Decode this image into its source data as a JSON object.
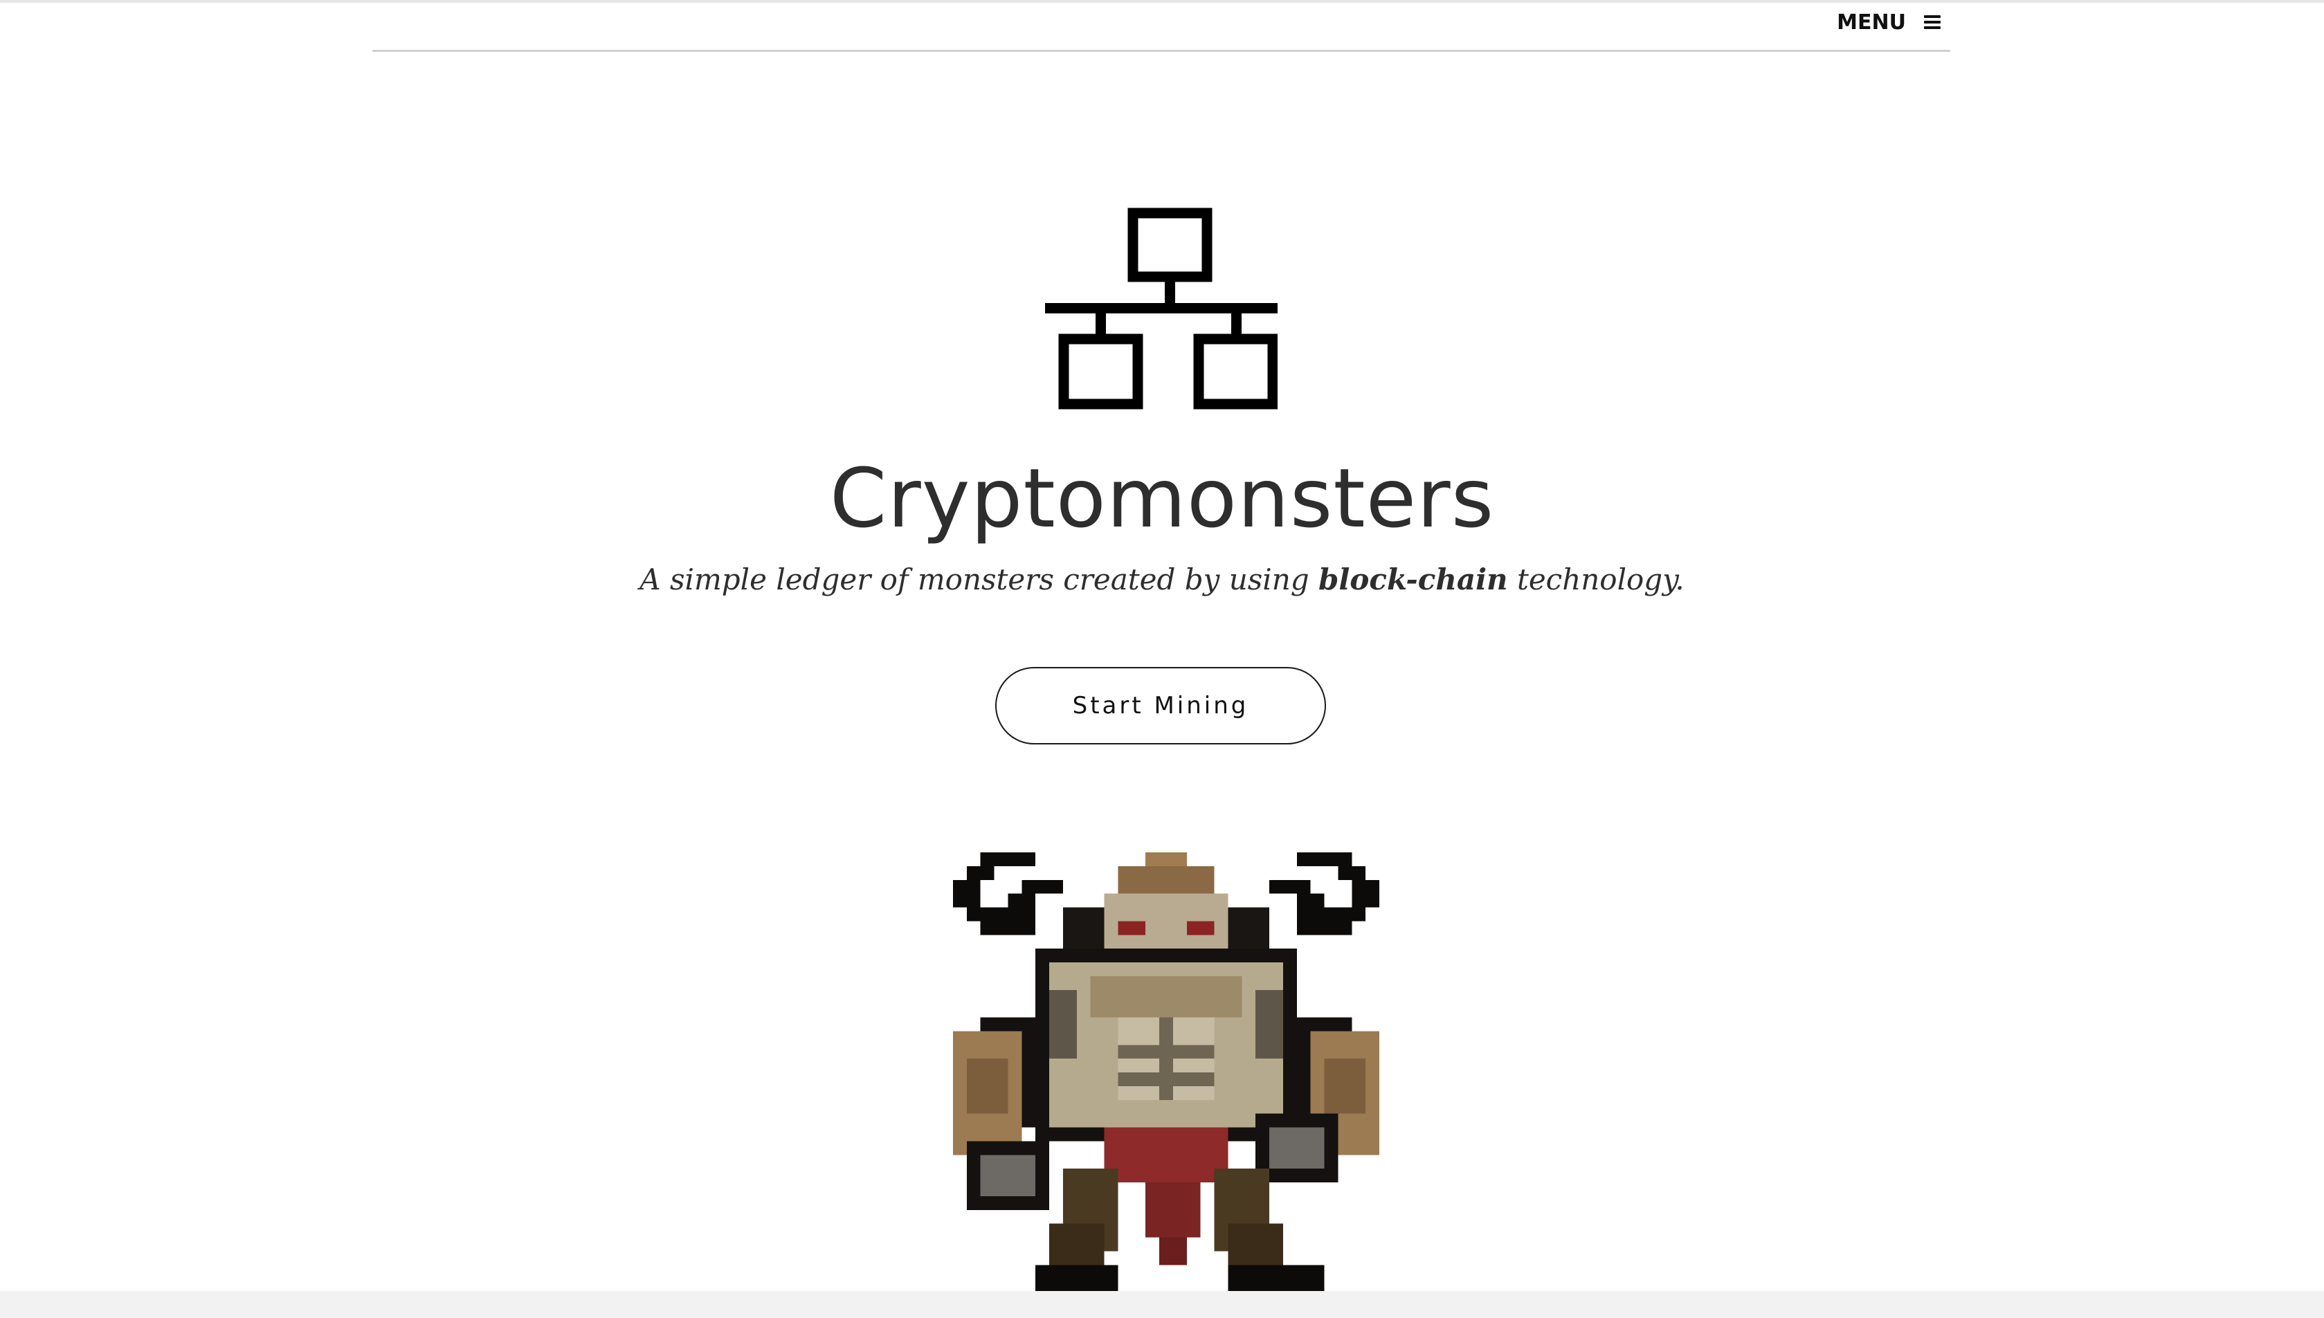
{
  "header": {
    "menu_label": "MENU",
    "menu_icon": "hamburger-icon"
  },
  "hero": {
    "icon": "network-icon",
    "title": "Cryptomonsters",
    "subtitle_before": "A simple ledger of monsters created by using ",
    "subtitle_emphasis": "block-chain",
    "subtitle_after": " technology.",
    "cta_label": "Start Mining"
  },
  "monster": {
    "image": "pixel-art-horned-monster"
  },
  "colors": {
    "text": "#2e2e2e",
    "icon": "#000000",
    "divider": "#cfcfcf",
    "background": "#ffffff"
  }
}
